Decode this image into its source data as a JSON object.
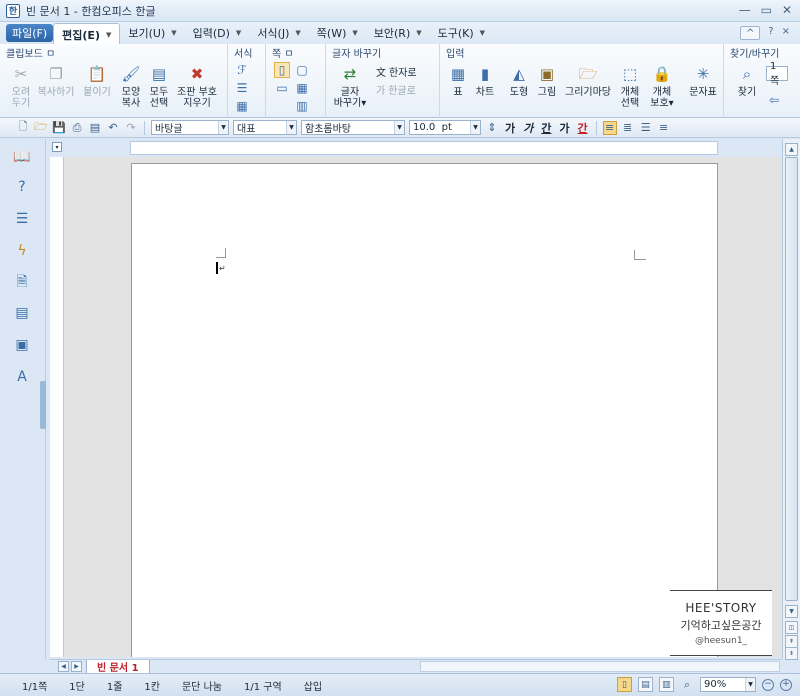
{
  "window": {
    "title": "빈 문서 1 - 한컴오피스 한글",
    "controls": [
      "—",
      "▭",
      "✕"
    ]
  },
  "menu": {
    "file": "파일(F)",
    "items": [
      {
        "label": "편집(E)",
        "active": true
      },
      {
        "label": "보기(U)"
      },
      {
        "label": "입력(D)"
      },
      {
        "label": "서식(J)"
      },
      {
        "label": "쪽(W)"
      },
      {
        "label": "보안(R)"
      },
      {
        "label": "도구(K)"
      }
    ],
    "right": {
      "collapse": "^",
      "help": "?",
      "close": "×"
    }
  },
  "ribbon": {
    "clipboard": {
      "label": "클립보드 ㅁ",
      "cut": "오려\n두기",
      "copy": "복사하기",
      "paste": "붙이기",
      "format_copy": "모양\n복사",
      "select_all": "모두\n선택",
      "remove_mark": "조판 부호\n지우기"
    },
    "format": {
      "label": "서식"
    },
    "page": {
      "label": "쪽 ㅁ"
    },
    "convert": {
      "label": "글자 바꾸기",
      "convert_btn": "글자\n바꾸기▾",
      "hanja": "한자로",
      "hangul": "한글로"
    },
    "insert": {
      "label": "입력",
      "table": "표",
      "chart": "차트",
      "shape": "도형",
      "picture": "그림",
      "drawing_wizard": "그리기마당",
      "object_select": "개체\n선택",
      "object_protect": "개체\n보호▾",
      "symbols": "문자표"
    },
    "find": {
      "label": "찾기/바꾸기",
      "find": "찾기",
      "combo": "1쪽"
    }
  },
  "toolbar": {
    "style": "바탕글",
    "lang": "대표",
    "font": "함초롬바탕",
    "size": "10.0",
    "unit": "pt",
    "bold": "가",
    "italic": "가",
    "underline": "간",
    "strike": "가",
    "color": "간"
  },
  "doc_tab": {
    "label": "빈 문서 1"
  },
  "status": {
    "items": [
      "1/1쪽",
      "1단",
      "1줄",
      "1칸",
      "문단 나눔",
      "1/1 구역",
      "삽입"
    ],
    "zoom": "90%"
  },
  "watermark": {
    "line1": "HEE'STORY",
    "line2": "기억하고싶은공간",
    "line3": "@heesun1_"
  }
}
